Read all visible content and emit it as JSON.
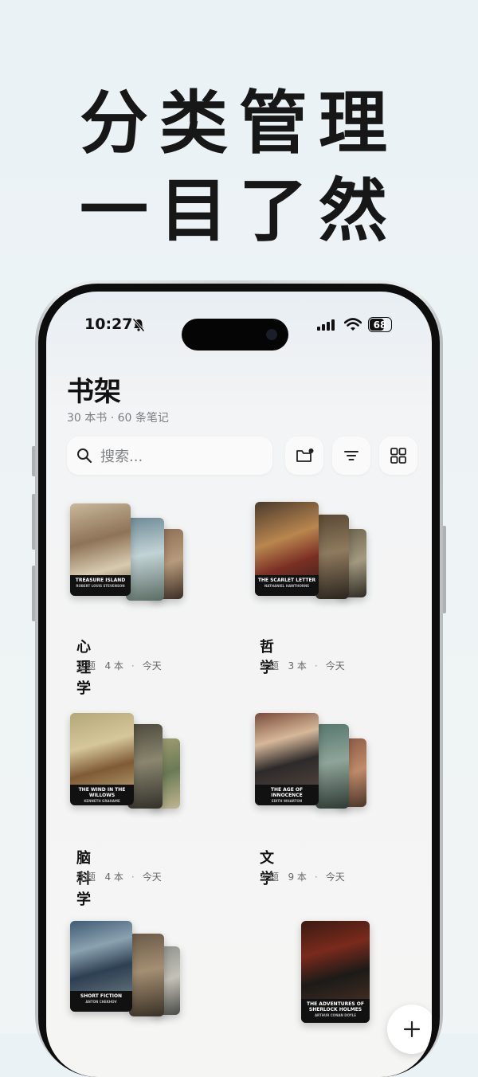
{
  "headline": {
    "line1": "分类管理",
    "line2": "一目了然"
  },
  "status_bar": {
    "time": "10:27",
    "battery": "68"
  },
  "shelf": {
    "title": "书架",
    "subtitle": "30 本书 · 60 条笔记",
    "search_placeholder": "搜索..."
  },
  "categories": [
    {
      "name": "心理学",
      "type": "主题",
      "count": "4 本",
      "date": "今天",
      "front_title": "TREASURE ISLAND",
      "front_author": "ROBERT LOUIS STEVENSON"
    },
    {
      "name": "哲学",
      "type": "主题",
      "count": "3 本",
      "date": "今天",
      "front_title": "THE SCARLET LETTER",
      "front_author": "NATHANIEL HAWTHORNE"
    },
    {
      "name": "脑科学",
      "type": "主题",
      "count": "4 本",
      "date": "今天",
      "front_title": "THE WIND IN THE WILLOWS",
      "front_author": "KENNETH GRAHAME"
    },
    {
      "name": "文学",
      "type": "主题",
      "count": "9 本",
      "date": "今天",
      "front_title": "THE AGE OF INNOCENCE",
      "front_author": "EDITH WHARTON"
    },
    {
      "front_title": "SHORT FICTION",
      "front_author": "ANTON CHEKHOV"
    },
    {
      "front_title": "THE ADVENTURES OF SHERLOCK HOLMES",
      "front_author": "ARTHUR CONAN DOYLE"
    }
  ]
}
